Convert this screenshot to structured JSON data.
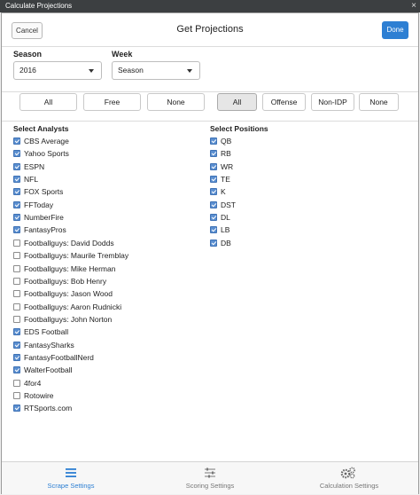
{
  "window": {
    "title": "Calculate Projections",
    "close_glyph": "×"
  },
  "header": {
    "cancel_label": "Cancel",
    "title": "Get Projections",
    "done_label": "Done"
  },
  "season": {
    "label": "Season",
    "value": "2016"
  },
  "week": {
    "label": "Week",
    "value": "Season"
  },
  "analyst_filter": {
    "all": "All",
    "free": "Free",
    "none": "None",
    "selected": "All"
  },
  "position_filter": {
    "all": "All",
    "offense": "Offense",
    "nonidp": "Non-IDP",
    "none": "None",
    "selected": "All"
  },
  "analysts": {
    "heading": "Select Analysts",
    "items": [
      {
        "label": "CBS Average",
        "checked": true
      },
      {
        "label": "Yahoo Sports",
        "checked": true
      },
      {
        "label": "ESPN",
        "checked": true
      },
      {
        "label": "NFL",
        "checked": true
      },
      {
        "label": "FOX Sports",
        "checked": true
      },
      {
        "label": "FFToday",
        "checked": true
      },
      {
        "label": "NumberFire",
        "checked": true
      },
      {
        "label": "FantasyPros",
        "checked": true
      },
      {
        "label": "Footballguys: David Dodds",
        "checked": false
      },
      {
        "label": "Footballguys: Maurile Tremblay",
        "checked": false
      },
      {
        "label": "Footballguys: Mike Herman",
        "checked": false
      },
      {
        "label": "Footballguys: Bob Henry",
        "checked": false
      },
      {
        "label": "Footballguys: Jason Wood",
        "checked": false
      },
      {
        "label": "Footballguys: Aaron Rudnicki",
        "checked": false
      },
      {
        "label": "Footballguys: John Norton",
        "checked": false
      },
      {
        "label": "EDS Football",
        "checked": true
      },
      {
        "label": "FantasySharks",
        "checked": true
      },
      {
        "label": "FantasyFootballNerd",
        "checked": true
      },
      {
        "label": "WalterFootball",
        "checked": true
      },
      {
        "label": "4for4",
        "checked": false
      },
      {
        "label": "Rotowire",
        "checked": false
      },
      {
        "label": "RTSports.com",
        "checked": true
      }
    ]
  },
  "positions": {
    "heading": "Select Positions",
    "items": [
      {
        "label": "QB",
        "checked": true
      },
      {
        "label": "RB",
        "checked": true
      },
      {
        "label": "WR",
        "checked": true
      },
      {
        "label": "TE",
        "checked": true
      },
      {
        "label": "K",
        "checked": true
      },
      {
        "label": "DST",
        "checked": true
      },
      {
        "label": "DL",
        "checked": true
      },
      {
        "label": "LB",
        "checked": true
      },
      {
        "label": "DB",
        "checked": true
      }
    ]
  },
  "tabs": [
    {
      "label": "Scrape Settings",
      "icon": "hamburger-icon",
      "active": true
    },
    {
      "label": "Scoring Settings",
      "icon": "sliders-icon",
      "active": false
    },
    {
      "label": "Calculation Settings",
      "icon": "gears-icon",
      "active": false
    }
  ],
  "colors": {
    "accent": "#2d7fd3",
    "checkbox": "#5b8fd0"
  }
}
